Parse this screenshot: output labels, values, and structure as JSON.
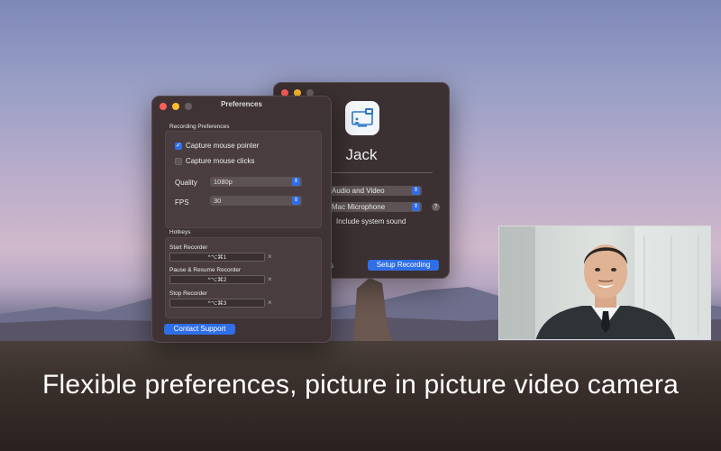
{
  "caption": "Flexible preferences, picture in picture video camera",
  "app_window": {
    "app_name": "Jack",
    "app_icon": "screen-recorder-icon",
    "source_select": "Audio and Video",
    "mic_select": "Mac Microphone",
    "help_glyph": "?",
    "include_system_sound": "Include system sound",
    "partial_label": "s",
    "setup_button": "Setup Recording"
  },
  "preferences": {
    "title": "Preferences",
    "recording_section": "Recording Preferences",
    "capture_pointer": {
      "label": "Capture mouse pointer",
      "checked": true
    },
    "capture_clicks": {
      "label": "Capture mouse clicks",
      "checked": false
    },
    "quality_label": "Quality",
    "quality_value": "1080p",
    "fps_label": "FPS",
    "fps_value": "30",
    "hotkeys_section": "Hotkeys",
    "hotkeys": [
      {
        "label": "Start Recorder",
        "keys": "^⌥⌘1"
      },
      {
        "label": "Pause & Resume Recorder",
        "keys": "^⌥⌘2"
      },
      {
        "label": "Stop Recorder",
        "keys": "^⌥⌘3"
      }
    ],
    "clear_glyph": "×",
    "contact_button": "Contact Support"
  },
  "colors": {
    "accent": "#2f6ee6",
    "window_bg": "#3e3234",
    "close": "#ff5f57",
    "minimize": "#febc2e"
  }
}
